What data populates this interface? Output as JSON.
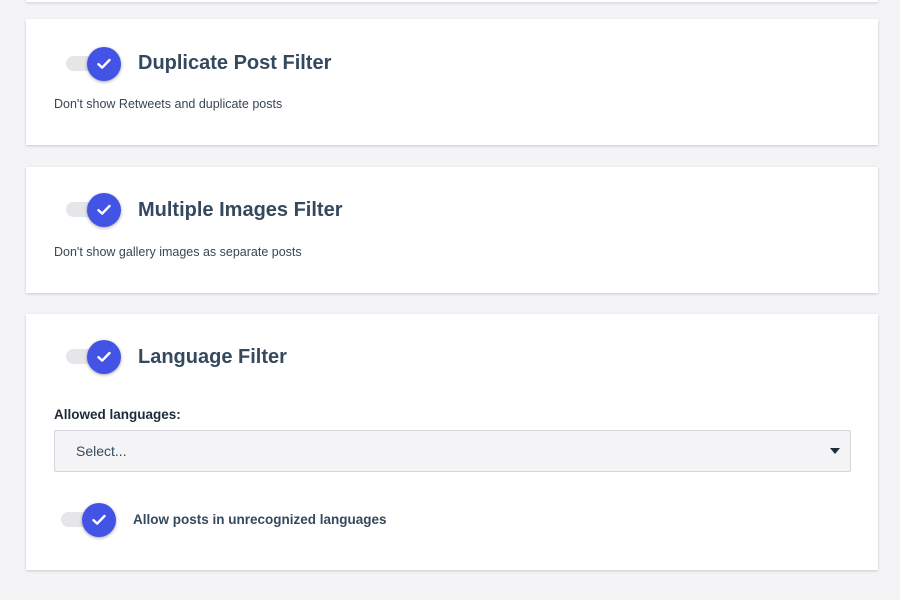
{
  "filters": [
    {
      "title": "Duplicate Post Filter",
      "description": "Don't show Retweets and duplicate posts",
      "enabled": true
    },
    {
      "title": "Multiple Images Filter",
      "description": "Don't show gallery images as separate posts",
      "enabled": true
    },
    {
      "title": "Language Filter",
      "enabled": true,
      "allowed_languages_label": "Allowed languages:",
      "select_placeholder": "Select...",
      "unrecognized_toggle_label": "Allow posts in unrecognized languages",
      "unrecognized_enabled": true
    }
  ],
  "colors": {
    "toggle_on": "#4353e6",
    "toggle_track": "#e6e6ea",
    "card_bg": "#ffffff",
    "page_bg": "#f4f4f7",
    "title_text": "#34495e"
  },
  "icons": {
    "toggle_knob": "checkmark-icon",
    "select_caret": "caret-down-icon"
  }
}
